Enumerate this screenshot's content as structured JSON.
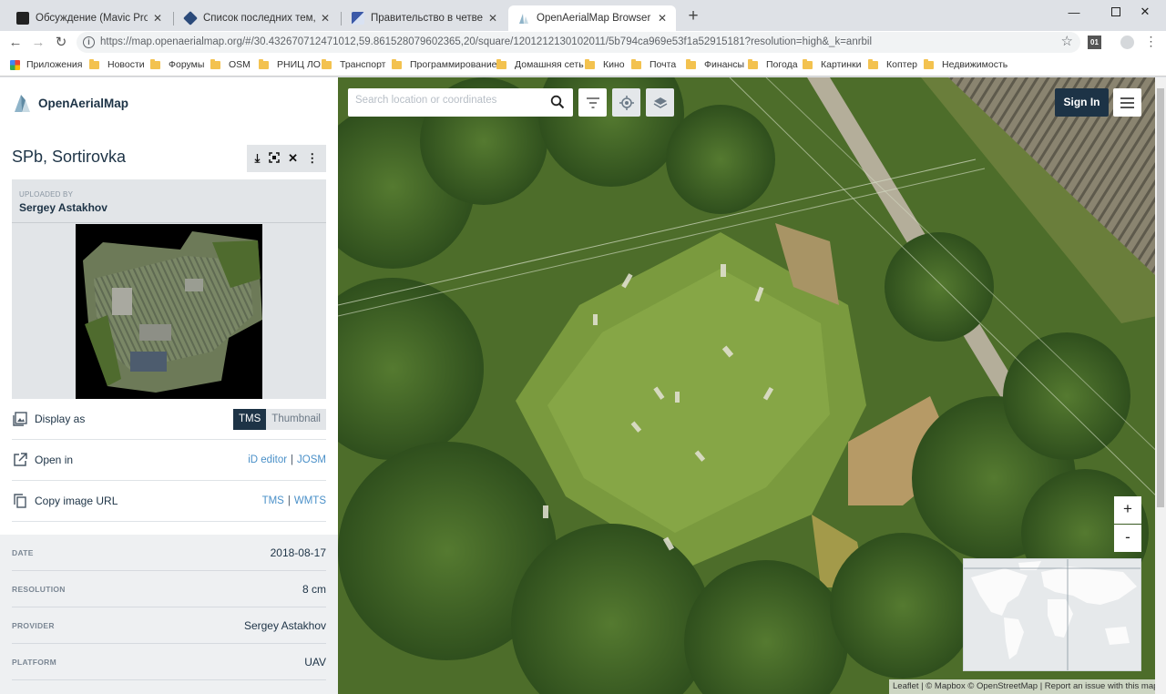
{
  "browser": {
    "tabs": [
      {
        "title": "Обсуждение (Mavic Pro) - Стра",
        "active": false
      },
      {
        "title": "Список последних тем, в котор",
        "active": false
      },
      {
        "title": "Правительство в четвертый ра",
        "active": false
      },
      {
        "title": "OpenAerialMap Browser",
        "active": true
      }
    ],
    "url": "https://map.openaerialmap.org/#/30.432670712471012,59.861528079602365,20/square/1201212130102011/5b794ca969e53f1a52915181?resolution=high&_k=anrbil",
    "bookmarks": [
      "Приложения",
      "Новости",
      "Форумы",
      "OSM",
      "РНИЦ ЛО",
      "Транспорт",
      "Программирование",
      "Домашняя сеть",
      "Кино",
      "Почта",
      "Финансы",
      "Погода",
      "Картинки",
      "Коптер",
      "Недвижимость"
    ],
    "extension_badge": "01"
  },
  "app": {
    "brand": "OpenAerialMap",
    "image": {
      "title": "SPb, Sortirovka",
      "uploaded_by_caption": "UPLOADED BY",
      "uploader": "Sergey Astakhov"
    },
    "display_as": {
      "label": "Display as",
      "options": [
        "TMS",
        "Thumbnail"
      ],
      "selected": "TMS"
    },
    "open_in": {
      "label": "Open in",
      "links": [
        "iD editor",
        "JOSM"
      ]
    },
    "copy_url": {
      "label": "Copy image URL",
      "links": [
        "TMS",
        "WMTS"
      ]
    },
    "metadata": [
      {
        "key": "DATE",
        "value": "2018-08-17"
      },
      {
        "key": "RESOLUTION",
        "value": "8 cm"
      },
      {
        "key": "PROVIDER",
        "value": "Sergey Astakhov"
      },
      {
        "key": "PLATFORM",
        "value": "UAV"
      }
    ]
  },
  "map": {
    "search_placeholder": "Search location or coordinates",
    "sign_in": "Sign In",
    "zoom_in": "+",
    "zoom_out": "-",
    "attribution": "Leaflet | © Mapbox © OpenStreetMap | Report an issue with this map"
  },
  "colors": {
    "accent": "#1d3346",
    "link": "#4a90c8",
    "grass": "#6f8f3a",
    "forest": "#3f6428"
  }
}
